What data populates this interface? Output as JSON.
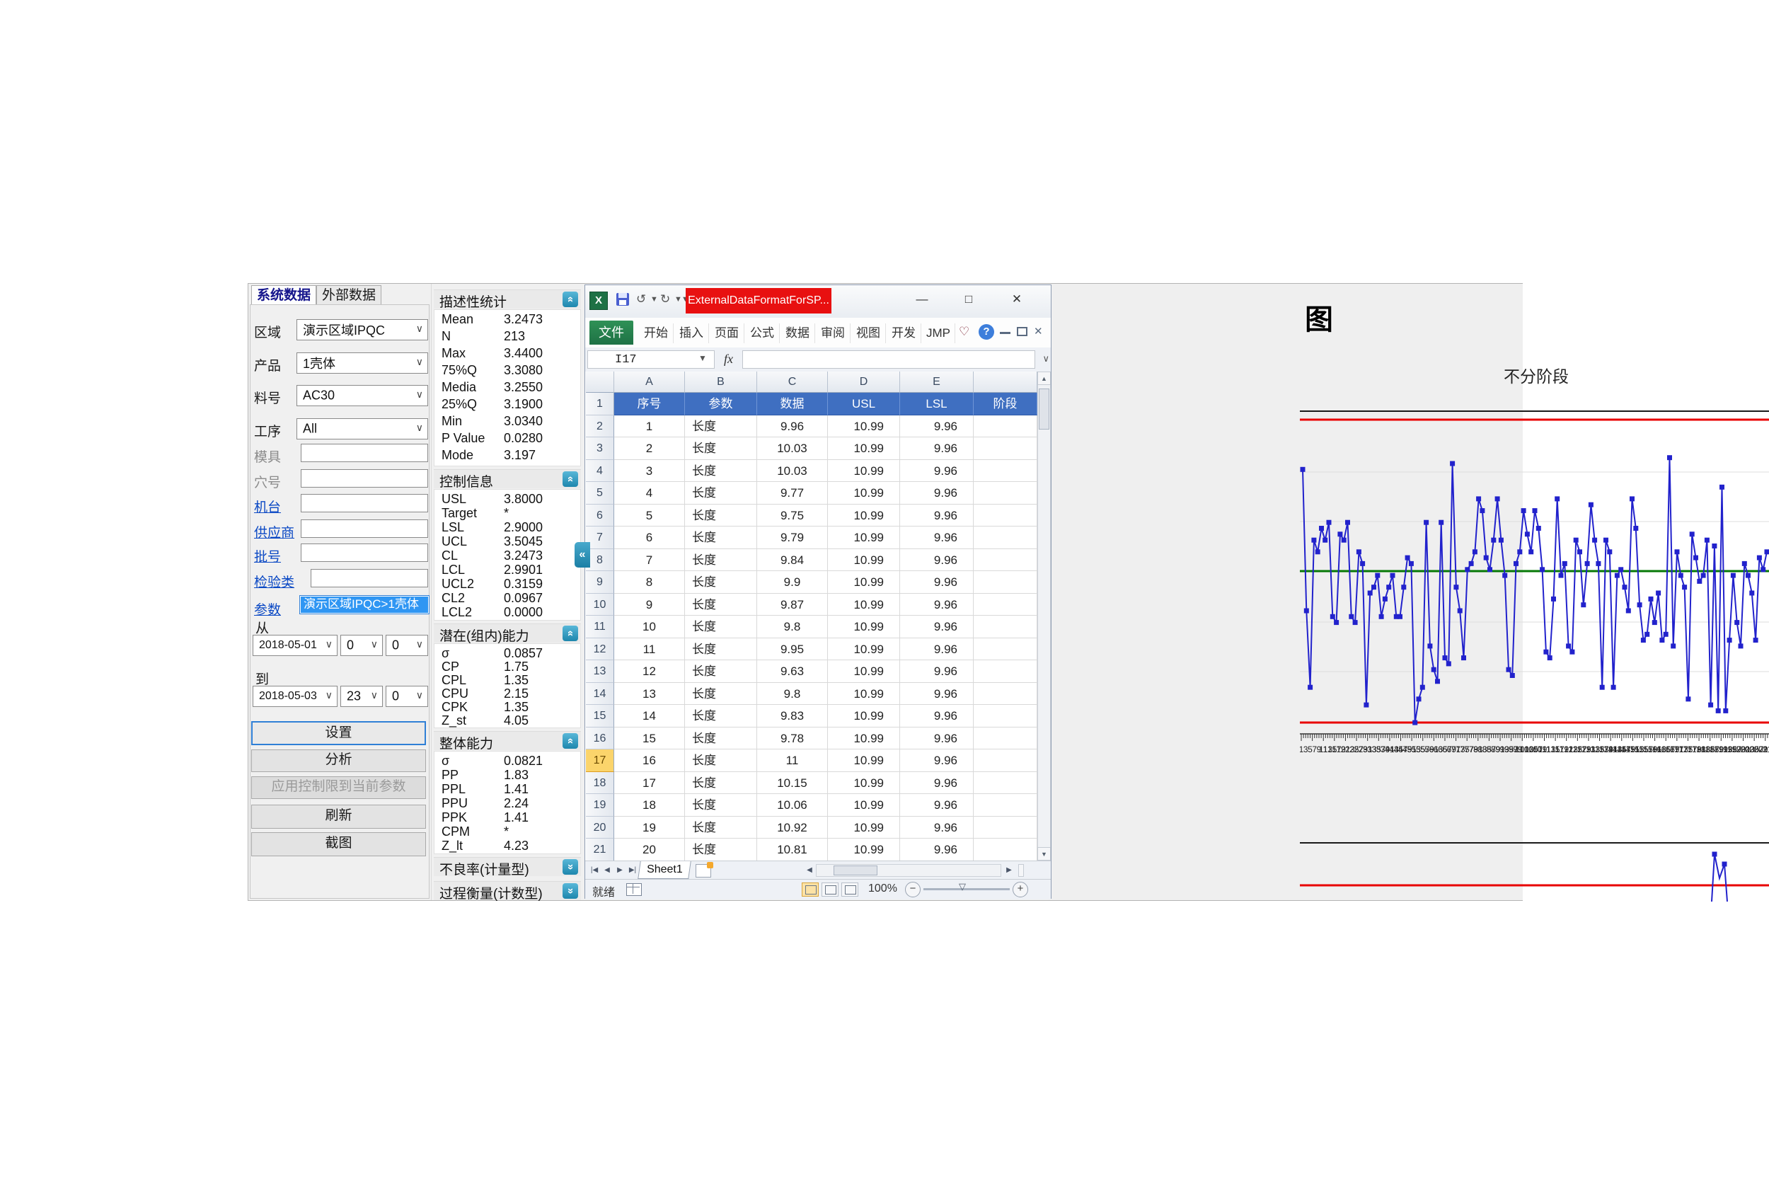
{
  "app": {
    "left_panel": {
      "tabs": [
        {
          "label": "系统数据",
          "active": true
        },
        {
          "label": "外部数据",
          "active": false
        }
      ],
      "fields": [
        {
          "label": "区域",
          "type": "select",
          "value": "演示区域IPQC",
          "style": "normal"
        },
        {
          "label": "产品",
          "type": "select",
          "value": "1壳体",
          "style": "normal"
        },
        {
          "label": "料号",
          "type": "select",
          "value": "AC30",
          "style": "normal"
        },
        {
          "label": "工序",
          "type": "select",
          "value": "All",
          "style": "normal"
        },
        {
          "label": "模具",
          "type": "input",
          "value": "",
          "style": "muted"
        },
        {
          "label": "穴号",
          "type": "input",
          "value": "",
          "style": "muted"
        },
        {
          "label": "机台",
          "type": "input",
          "value": "",
          "style": "link"
        },
        {
          "label": "供应商",
          "type": "input",
          "value": "",
          "style": "link"
        },
        {
          "label": "批号",
          "type": "input",
          "value": "",
          "style": "link"
        },
        {
          "label": "检验类",
          "type": "input",
          "value": "",
          "style": "link"
        }
      ],
      "param": {
        "label": "参数",
        "selected_item": "演示区域IPQC>1壳体"
      },
      "date_range": {
        "from_label": "从",
        "from_date": "2018-05-01",
        "from_hour": "0",
        "from_minute": "0",
        "to_label": "到",
        "to_date": "2018-05-03",
        "to_hour": "23",
        "to_minute": "0"
      },
      "buttons": [
        {
          "label": "设置",
          "state": "focused"
        },
        {
          "label": "分析",
          "state": "normal"
        },
        {
          "label": "应用控制限到当前参数",
          "state": "disabled"
        },
        {
          "label": "刷新",
          "state": "normal"
        },
        {
          "label": "截图",
          "state": "normal"
        }
      ]
    },
    "stats_panel": {
      "collapse_button_glyph": "«",
      "sections": [
        {
          "title": "描述性统计",
          "collapsed": false,
          "rows": [
            [
              "Mean",
              "3.2473"
            ],
            [
              "N",
              "213"
            ],
            [
              "Max",
              "3.4400"
            ],
            [
              "75%Q",
              "3.3080"
            ],
            [
              "Media",
              "3.2550"
            ],
            [
              "25%Q",
              "3.1900"
            ],
            [
              "Min",
              "3.0340"
            ],
            [
              "P Value",
              "0.0280"
            ],
            [
              "Mode",
              "3.197"
            ]
          ]
        },
        {
          "title": "控制信息",
          "collapsed": false,
          "rows": [
            [
              "USL",
              "3.8000"
            ],
            [
              "Target",
              "*"
            ],
            [
              "LSL",
              "2.9000"
            ],
            [
              "UCL",
              "3.5045"
            ],
            [
              "CL",
              "3.2473"
            ],
            [
              "LCL",
              "2.9901"
            ],
            [
              "UCL2",
              "0.3159"
            ],
            [
              "CL2",
              "0.0967"
            ],
            [
              "LCL2",
              "0.0000"
            ]
          ]
        },
        {
          "title": "潜在(组内)能力",
          "collapsed": false,
          "rows": [
            [
              "σ",
              "0.0857"
            ],
            [
              "CP",
              "1.75"
            ],
            [
              "CPL",
              "1.35"
            ],
            [
              "CPU",
              "2.15"
            ],
            [
              "CPK",
              "1.35"
            ],
            [
              "Z_st",
              "4.05"
            ]
          ]
        },
        {
          "title": "整体能力",
          "collapsed": false,
          "rows": [
            [
              "σ",
              "0.0821"
            ],
            [
              "PP",
              "1.83"
            ],
            [
              "PPL",
              "1.41"
            ],
            [
              "PPU",
              "2.24"
            ],
            [
              "PPK",
              "1.41"
            ],
            [
              "CPM",
              "*"
            ],
            [
              "Z_lt",
              "4.23"
            ]
          ]
        },
        {
          "title": "不良率(计量型)",
          "collapsed": true,
          "rows": []
        },
        {
          "title": "过程衡量(计数型)",
          "collapsed": true,
          "rows": []
        }
      ]
    },
    "chart_panel": {
      "corner_title": "图",
      "chart_title": "不分阶段"
    }
  },
  "excel": {
    "title": "ExternalDataFormatForSP...",
    "file_tab": "文件",
    "ribbon_tabs": [
      "开始",
      "插入",
      "页面",
      "公式",
      "数据",
      "审阅",
      "视图",
      "开发",
      "JMP"
    ],
    "name_box": "I17",
    "fx_label": "fx",
    "columns": [
      "A",
      "B",
      "C",
      "D",
      "E",
      ""
    ],
    "header_row": [
      "序号",
      "参数",
      "数据",
      "USL",
      "LSL",
      "阶段"
    ],
    "rows": [
      [
        "1",
        "长度",
        "9.96",
        "10.99",
        "9.96",
        ""
      ],
      [
        "2",
        "长度",
        "10.03",
        "10.99",
        "9.96",
        ""
      ],
      [
        "3",
        "长度",
        "10.03",
        "10.99",
        "9.96",
        ""
      ],
      [
        "4",
        "长度",
        "9.77",
        "10.99",
        "9.96",
        ""
      ],
      [
        "5",
        "长度",
        "9.75",
        "10.99",
        "9.96",
        ""
      ],
      [
        "6",
        "长度",
        "9.79",
        "10.99",
        "9.96",
        ""
      ],
      [
        "7",
        "长度",
        "9.84",
        "10.99",
        "9.96",
        ""
      ],
      [
        "8",
        "长度",
        "9.9",
        "10.99",
        "9.96",
        ""
      ],
      [
        "9",
        "长度",
        "9.87",
        "10.99",
        "9.96",
        ""
      ],
      [
        "10",
        "长度",
        "9.8",
        "10.99",
        "9.96",
        ""
      ],
      [
        "11",
        "长度",
        "9.95",
        "10.99",
        "9.96",
        ""
      ],
      [
        "12",
        "长度",
        "9.63",
        "10.99",
        "9.96",
        ""
      ],
      [
        "13",
        "长度",
        "9.8",
        "10.99",
        "9.96",
        ""
      ],
      [
        "14",
        "长度",
        "9.83",
        "10.99",
        "9.96",
        ""
      ],
      [
        "15",
        "长度",
        "9.78",
        "10.99",
        "9.96",
        ""
      ],
      [
        "16",
        "长度",
        "11",
        "10.99",
        "9.96",
        ""
      ],
      [
        "17",
        "长度",
        "10.15",
        "10.99",
        "9.96",
        ""
      ],
      [
        "18",
        "长度",
        "10.06",
        "10.99",
        "9.96",
        ""
      ],
      [
        "19",
        "长度",
        "10.92",
        "10.99",
        "9.96",
        ""
      ],
      [
        "20",
        "长度",
        "10.81",
        "10.99",
        "9.96",
        ""
      ]
    ],
    "selected_row_number": 17,
    "sheet_tab": "Sheet1",
    "status": {
      "ready": "就绪",
      "zoom": "100%"
    }
  },
  "chart_data": {
    "type": "line",
    "title": "不分阶段",
    "ucl": 3.5045,
    "cl": 3.2473,
    "lcl": 2.9901,
    "x_ticks": 213,
    "values": [
      3.42,
      3.18,
      3.05,
      3.3,
      3.28,
      3.32,
      3.3,
      3.33,
      3.17,
      3.16,
      3.31,
      3.3,
      3.33,
      3.17,
      3.16,
      3.28,
      3.26,
      3.02,
      3.21,
      3.22,
      3.24,
      3.17,
      3.2,
      3.22,
      3.24,
      3.17,
      3.17,
      3.22,
      3.27,
      3.26,
      2.99,
      3.03,
      3.05,
      3.33,
      3.12,
      3.08,
      3.06,
      3.33,
      3.1,
      3.09,
      3.43,
      3.22,
      3.18,
      3.1,
      3.25,
      3.26,
      3.28,
      3.37,
      3.35,
      3.27,
      3.25,
      3.3,
      3.37,
      3.3,
      3.24,
      3.08,
      3.07,
      3.26,
      3.28,
      3.35,
      3.31,
      3.28,
      3.35,
      3.32,
      3.25,
      3.11,
      3.1,
      3.2,
      3.37,
      3.24,
      3.26,
      3.12,
      3.11,
      3.3,
      3.28,
      3.19,
      3.26,
      3.36,
      3.3,
      3.26,
      3.05,
      3.3,
      3.28,
      3.05,
      3.24,
      3.25,
      3.22,
      3.18,
      3.37,
      3.32,
      3.19,
      3.13,
      3.14,
      3.2,
      3.16,
      3.21,
      3.13,
      3.14,
      3.44,
      3.12,
      3.28,
      3.24,
      3.22,
      3.03,
      3.31,
      3.27,
      3.23,
      3.24,
      3.3,
      3.02,
      3.29,
      3.01,
      3.39,
      3.01,
      3.13,
      3.24,
      3.16,
      3.12,
      3.26,
      3.24,
      3.21,
      3.13,
      3.27,
      3.25,
      3.28
    ],
    "mr_chart": {
      "ucl2": 0.3159,
      "cl2": 0.0967,
      "visible_spike_values": [
        0.4,
        0.36
      ]
    }
  }
}
